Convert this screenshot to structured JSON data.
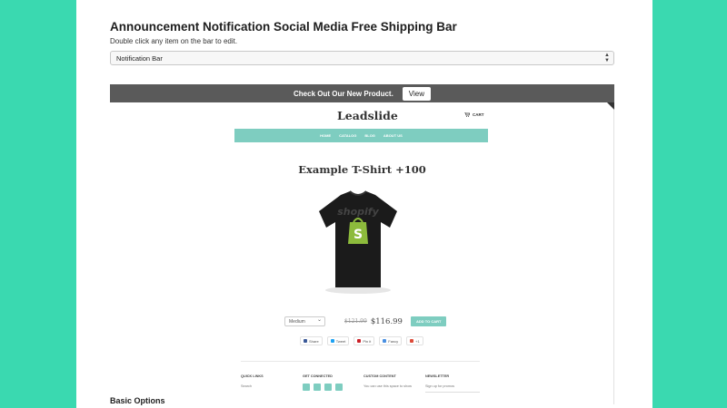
{
  "header": {
    "title": "Announcement Notification Social Media Free Shipping Bar",
    "subtitle": "Double click any item on the bar to edit."
  },
  "bar_type_select": {
    "value": "Notification Bar"
  },
  "notification_bar": {
    "message": "Check Out Our New Product.",
    "button_label": "View",
    "background_color": "#5a5a5a"
  },
  "preview": {
    "store_name": "Leadslide",
    "cart_label": "CART",
    "nav": [
      "HOME",
      "CATALOG",
      "BLOG",
      "ABOUT US"
    ],
    "product_title": "Example T-Shirt +100",
    "shirt_brand": "shopify",
    "size": "Medium",
    "old_price": "$121.99",
    "new_price": "$116.99",
    "add_to_cart": "ADD TO CART",
    "social": [
      "Share",
      "Tweet",
      "Pin it",
      "Fancy",
      "+1"
    ],
    "footer": {
      "quick_links": {
        "heading": "QUICK LINKS",
        "item": "Search"
      },
      "get_connected": {
        "heading": "GET CONNECTED"
      },
      "custom_content": {
        "heading": "CUSTOM CONTENT",
        "text": "You can use this space to show"
      },
      "newsletter": {
        "heading": "NEWSLETTER",
        "text": "Sign up for promos"
      }
    },
    "side_tab_icons": [
      "twitter-icon",
      "facebook-icon",
      "instagram-icon"
    ],
    "accent_color": "#7ecdc0"
  },
  "sections": {
    "basic_options": "Basic Options"
  },
  "colors": {
    "page_background": "#3ad9b0"
  }
}
